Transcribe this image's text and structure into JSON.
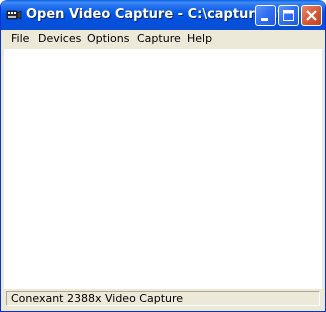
{
  "window": {
    "title": "Open Video Capture - C:\\capture.avi",
    "controls": {
      "minimize_icon": "minimize-icon",
      "maximize_icon": "maximize-icon",
      "close_icon": "close-icon"
    },
    "app_icon": "video-camera-icon"
  },
  "menubar": {
    "items": [
      {
        "label": "File"
      },
      {
        "label": "Devices"
      },
      {
        "label": "Options"
      },
      {
        "label": "Capture"
      },
      {
        "label": "Help"
      }
    ]
  },
  "statusbar": {
    "text": "Conexant 2388x Video Capture"
  },
  "colors": {
    "titlebar": "#0458e4",
    "face": "#ece9d8",
    "client": "#ffffff",
    "close_button": "#d85a39"
  }
}
